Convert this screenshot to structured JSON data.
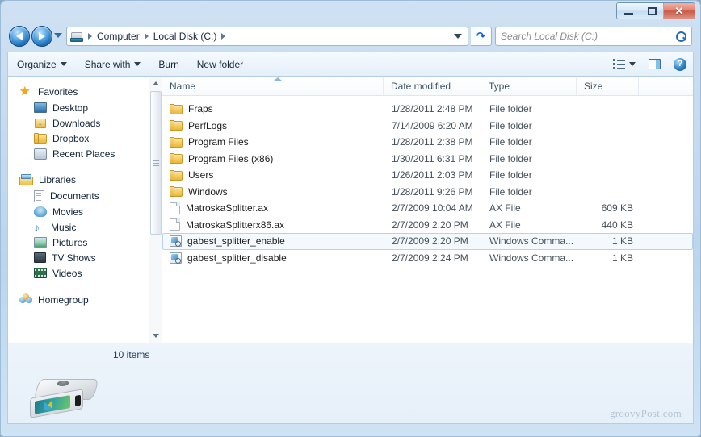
{
  "window": {
    "buttons": {
      "minimize": "–",
      "maximize": "□",
      "close": "✕"
    }
  },
  "address_bar": {
    "back_tooltip": "Back",
    "forward_tooltip": "Forward",
    "drive_icon": "hard-drive-icon",
    "breadcrumbs": [
      "Computer",
      "Local Disk (C:)"
    ],
    "refresh_label": "↻"
  },
  "search": {
    "placeholder": "Search Local Disk (C:)",
    "value": "",
    "icon": "search-icon"
  },
  "toolbar": {
    "organize_label": "Organize",
    "share_with_label": "Share with",
    "burn_label": "Burn",
    "new_folder_label": "New folder",
    "view_icon": "list-view-icon",
    "preview_pane_icon": "preview-pane-icon",
    "help_label": "?"
  },
  "sidebar": {
    "groups": [
      {
        "label": "Favorites",
        "icon": "star-icon",
        "items": [
          {
            "label": "Desktop",
            "icon": "desktop-icon"
          },
          {
            "label": "Downloads",
            "icon": "downloads-folder-icon"
          },
          {
            "label": "Dropbox",
            "icon": "folder-icon"
          },
          {
            "label": "Recent Places",
            "icon": "recent-places-icon"
          }
        ]
      },
      {
        "label": "Libraries",
        "icon": "libraries-icon",
        "items": [
          {
            "label": "Documents",
            "icon": "documents-icon"
          },
          {
            "label": "Movies",
            "icon": "movies-icon"
          },
          {
            "label": "Music",
            "icon": "music-icon"
          },
          {
            "label": "Pictures",
            "icon": "pictures-icon"
          },
          {
            "label": "TV Shows",
            "icon": "tv-shows-icon"
          },
          {
            "label": "Videos",
            "icon": "videos-icon"
          }
        ]
      },
      {
        "label": "Homegroup",
        "icon": "homegroup-icon",
        "items": []
      }
    ]
  },
  "file_list": {
    "columns": [
      "Name",
      "Date modified",
      "Type",
      "Size"
    ],
    "sort_column": "Name",
    "sort_direction": "ascending",
    "rows": [
      {
        "name": "Fraps",
        "date": "1/28/2011 2:48 PM",
        "type": "File folder",
        "size": "",
        "icon": "folder-icon",
        "selected": false
      },
      {
        "name": "PerfLogs",
        "date": "7/14/2009 6:20 AM",
        "type": "File folder",
        "size": "",
        "icon": "folder-icon",
        "selected": false
      },
      {
        "name": "Program Files",
        "date": "1/28/2011 2:38 PM",
        "type": "File folder",
        "size": "",
        "icon": "folder-icon",
        "selected": false
      },
      {
        "name": "Program Files (x86)",
        "date": "1/30/2011 6:31 PM",
        "type": "File folder",
        "size": "",
        "icon": "folder-icon",
        "selected": false
      },
      {
        "name": "Users",
        "date": "1/26/2011 2:03 PM",
        "type": "File folder",
        "size": "",
        "icon": "folder-icon",
        "selected": false
      },
      {
        "name": "Windows",
        "date": "1/28/2011 9:26 PM",
        "type": "File folder",
        "size": "",
        "icon": "folder-icon",
        "selected": false
      },
      {
        "name": "MatroskaSplitter.ax",
        "date": "2/7/2009 10:04 AM",
        "type": "AX File",
        "size": "609 KB",
        "icon": "file-icon",
        "selected": false
      },
      {
        "name": "MatroskaSplitterx86.ax",
        "date": "2/7/2009 2:20 PM",
        "type": "AX File",
        "size": "440 KB",
        "icon": "file-icon",
        "selected": false
      },
      {
        "name": "gabest_splitter_enable",
        "date": "2/7/2009 2:20 PM",
        "type": "Windows Comma...",
        "size": "1 KB",
        "icon": "registry-icon",
        "selected": true
      },
      {
        "name": "gabest_splitter_disable",
        "date": "2/7/2009 2:24 PM",
        "type": "Windows Comma...",
        "size": "1 KB",
        "icon": "registry-icon",
        "selected": false
      }
    ]
  },
  "status_bar": {
    "item_count": "10 items",
    "drive_icon": "local-disk-icon"
  },
  "watermark": "groovyPost.com",
  "colors": {
    "accent": "#2f7fc0",
    "frame": "#c3d9ee",
    "selection_border": "#b5d4ec",
    "selection_fill": "#f4f9fd",
    "folder": "#eab93c"
  }
}
